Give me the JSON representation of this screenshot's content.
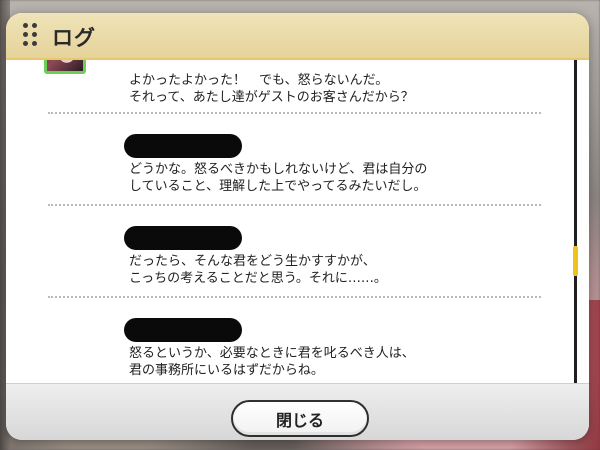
{
  "dialog": {
    "title": "ログ",
    "close_label": "閉じる"
  },
  "log": {
    "entries": [
      {
        "has_avatar": true,
        "name_redacted": false,
        "text": "よかったよかった！　でも、怒らないんだ。\nそれって、あたし達がゲストのお客さんだから？"
      },
      {
        "has_avatar": false,
        "name_redacted": true,
        "text": "どうかな。怒るべきかもしれないけど、君は自分の\nしていること、理解した上でやってるみたいだし。"
      },
      {
        "has_avatar": false,
        "name_redacted": true,
        "text": "だったら、そんな君をどう生かすすかが、\nこっちの考えることだと思う。それに……。"
      },
      {
        "has_avatar": false,
        "name_redacted": true,
        "text": "怒るというか、必要なときに君を叱るべき人は、\n君の事務所にいるはずだからね。"
      }
    ]
  },
  "colors": {
    "header_gold": "#e6d39a",
    "header_border": "#e6c96d",
    "avatar_border": "#6ccf56",
    "scroll_thumb": "#f0c21b"
  },
  "icons": {
    "grip": "grip-dots-icon"
  }
}
